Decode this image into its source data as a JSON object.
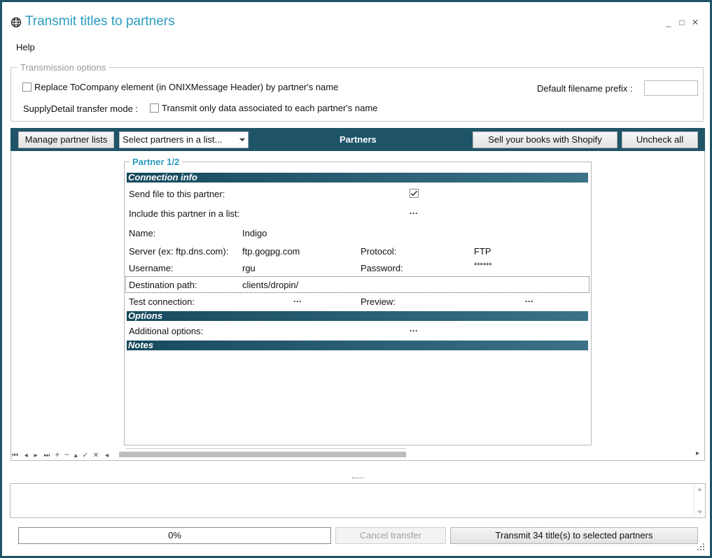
{
  "window": {
    "title": "Transmit titles to partners",
    "controls": {
      "minimize": "_",
      "maximize": "□",
      "close": "✕"
    }
  },
  "menu": {
    "help": "Help"
  },
  "transmission_options": {
    "legend": "Transmission options",
    "replace_label": "Replace ToCompany element (in ONIXMessage Header) by partner's name",
    "replace_checked": false,
    "supply_mode_label": "SupplyDetail transfer mode :",
    "transmit_only_label": "Transmit only data associated to each partner's name",
    "transmit_only_checked": false,
    "prefix_label": "Default filename prefix :",
    "prefix_value": ""
  },
  "toolbar": {
    "manage_lists": "Manage partner lists",
    "select_partners": "Select partners in a list...",
    "center_title": "Partners",
    "shopify": "Sell your books with Shopify",
    "uncheck_all": "Uncheck all"
  },
  "partner": {
    "legend": "Partner 1/2",
    "connection_header": "Connection info",
    "send_label": "Send file to this partner:",
    "send_checked": true,
    "include_label": "Include this partner in a list:",
    "ellipsis": "···",
    "name_label": "Name:",
    "name_value": "Indigo",
    "server_label": "Server (ex: ftp.dns.com):",
    "server_value": "ftp.gogpg.com",
    "protocol_label": "Protocol:",
    "protocol_value": "FTP",
    "username_label": "Username:",
    "username_value": "rgu",
    "password_label": "Password:",
    "password_value": "******",
    "dest_label": "Destination path:",
    "dest_value": "clients/dropin/",
    "test_label": "Test connection:",
    "preview_label": "Preview:",
    "options_header": "Options",
    "additional_label": "Additional options:",
    "notes_header": "Notes"
  },
  "navigator": {
    "first": "⏮",
    "prev": "◂",
    "next": "▸",
    "last": "⏭",
    "add": "+",
    "remove": "−",
    "up": "▴",
    "confirm": "✓",
    "cancel": "✕",
    "scroll_left": "◂",
    "scroll_right": "▸"
  },
  "footer": {
    "progress_text": "0%",
    "progress": 0,
    "cancel_transfer": "Cancel transfer",
    "transmit_button": "Transmit 34 title(s) to selected partners"
  },
  "colors": {
    "accent": "#2a9bbf",
    "toolbar": "#1f5468",
    "section": "#174a5e"
  }
}
